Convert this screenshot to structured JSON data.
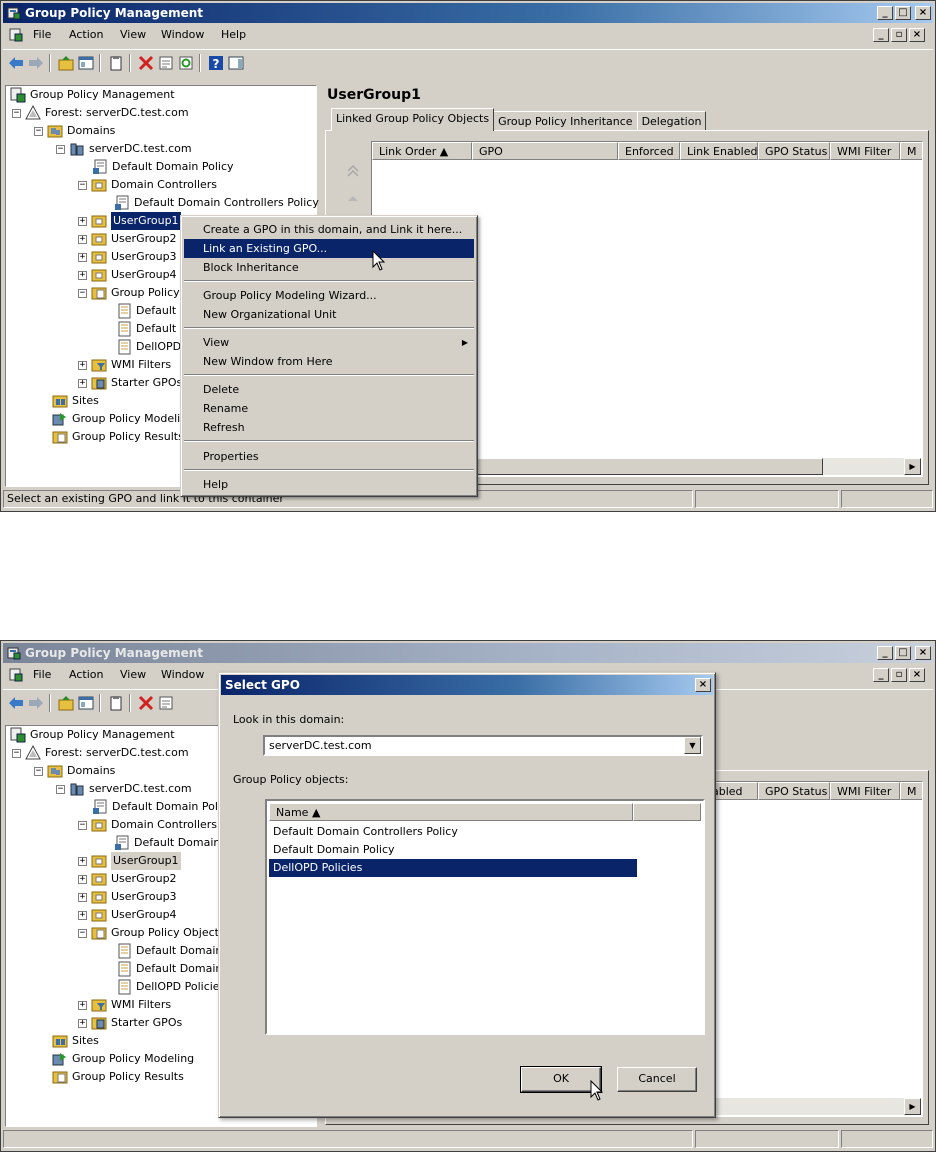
{
  "top": {
    "window_title": "Group Policy Management",
    "menu": [
      "File",
      "Action",
      "View",
      "Window",
      "Help"
    ],
    "tree": {
      "root": "Group Policy Management",
      "forest": "Forest: serverDC.test.com",
      "domains": "Domains",
      "domain": "serverDC.test.com",
      "default_domain_policy": "Default Domain Policy",
      "domain_controllers": "Domain Controllers",
      "default_dc_policy": "Default Domain Controllers Policy",
      "usergroup1": "UserGroup1",
      "usergroup2": "UserGroup2",
      "usergroup3": "UserGroup3",
      "usergroup4": "UserGroup4",
      "gpo_container": "Group Policy",
      "gpo_item1": "Default D",
      "gpo_item2": "Default D",
      "gpo_item3": "DellOPD",
      "wmi_filters": "WMI Filters",
      "starter_gpos": "Starter GPOs",
      "sites": "Sites",
      "modeling": "Group Policy Modelin",
      "results": "Group Policy Results"
    },
    "right": {
      "heading": "UserGroup1",
      "tabs": [
        "Linked Group Policy Objects",
        "Group Policy Inheritance",
        "Delegation"
      ],
      "columns": [
        "Link Order",
        "GPO",
        "Enforced",
        "Link Enabled",
        "GPO Status",
        "WMI Filter",
        "M"
      ]
    },
    "context_menu": {
      "create_link": "Create a GPO in this domain, and Link it here...",
      "link_existing": "Link an Existing GPO...",
      "block": "Block Inheritance",
      "wizard": "Group Policy Modeling Wizard...",
      "new_ou": "New Organizational Unit",
      "view": "View",
      "new_window": "New Window from Here",
      "delete": "Delete",
      "rename": "Rename",
      "refresh": "Refresh",
      "properties": "Properties",
      "help": "Help"
    },
    "status": "Select an existing GPO and link it to this container"
  },
  "bottom": {
    "window_title": "Group Policy Management",
    "menu": [
      "File",
      "Action",
      "View",
      "Window"
    ],
    "tree": {
      "root": "Group Policy Management",
      "forest": "Forest: serverDC.test.com",
      "domains": "Domains",
      "domain": "serverDC.test.com",
      "default_domain_policy": "Default Domain Poli",
      "domain_controllers": "Domain Controllers",
      "default_dc_policy": "Default Domain",
      "usergroup1": "UserGroup1",
      "usergroup2": "UserGroup2",
      "usergroup3": "UserGroup3",
      "usergroup4": "UserGroup4",
      "gpo_container": "Group Policy Object",
      "gpo_item1": "Default Domain",
      "gpo_item2": "Default Domain",
      "gpo_item3": "DellOPD Policies",
      "wmi_filters": "WMI Filters",
      "starter_gpos": "Starter GPOs",
      "sites": "Sites",
      "modeling": "Group Policy Modeling",
      "results": "Group Policy Results"
    },
    "columns_visible": [
      "nabled",
      "GPO Status",
      "WMI Filter",
      "M"
    ],
    "dialog": {
      "title": "Select GPO",
      "look_in_label": "Look in this domain:",
      "domain_value": "serverDC.test.com",
      "objects_label": "Group Policy objects:",
      "name_header": "Name",
      "items": [
        "Default Domain Controllers Policy",
        "Default Domain Policy",
        "DellOPD Policies"
      ],
      "selected_index": 2,
      "ok": "OK",
      "cancel": "Cancel"
    }
  },
  "colors": {
    "selection": "#0a246a",
    "face": "#d4d0c8"
  }
}
